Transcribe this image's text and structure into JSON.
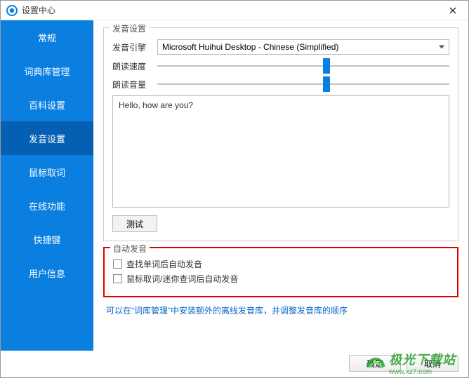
{
  "window": {
    "title": "设置中心"
  },
  "sidebar": {
    "items": [
      {
        "label": "常规"
      },
      {
        "label": "词典库管理"
      },
      {
        "label": "百科设置"
      },
      {
        "label": "发音设置"
      },
      {
        "label": "鼠标取词"
      },
      {
        "label": "在线功能"
      },
      {
        "label": "快捷键"
      },
      {
        "label": "用户信息"
      }
    ],
    "activeIndex": 3
  },
  "speech": {
    "groupTitle": "发音设置",
    "engineLabel": "发音引擎",
    "engineValue": "Microsoft Huihui Desktop - Chinese (Simplified)",
    "speedLabel": "朗读速度",
    "speedPercent": 58,
    "volumeLabel": "朗读音量",
    "volumePercent": 58,
    "sampleText": "Hello, how are you?",
    "testLabel": "测试"
  },
  "auto": {
    "groupTitle": "自动发音",
    "check1Label": "查找单词后自动发音",
    "check2Label": "鼠标取词/迷你查词后自动发音",
    "check1": false,
    "check2": false
  },
  "hint": "可以在“词库管理”中安装额外的离线发音库，并调整发音库的顺序",
  "footer": {
    "ok": "确定",
    "cancel": "取消"
  },
  "watermark": {
    "name": "极光下载站",
    "url": "www.xz7.com"
  }
}
